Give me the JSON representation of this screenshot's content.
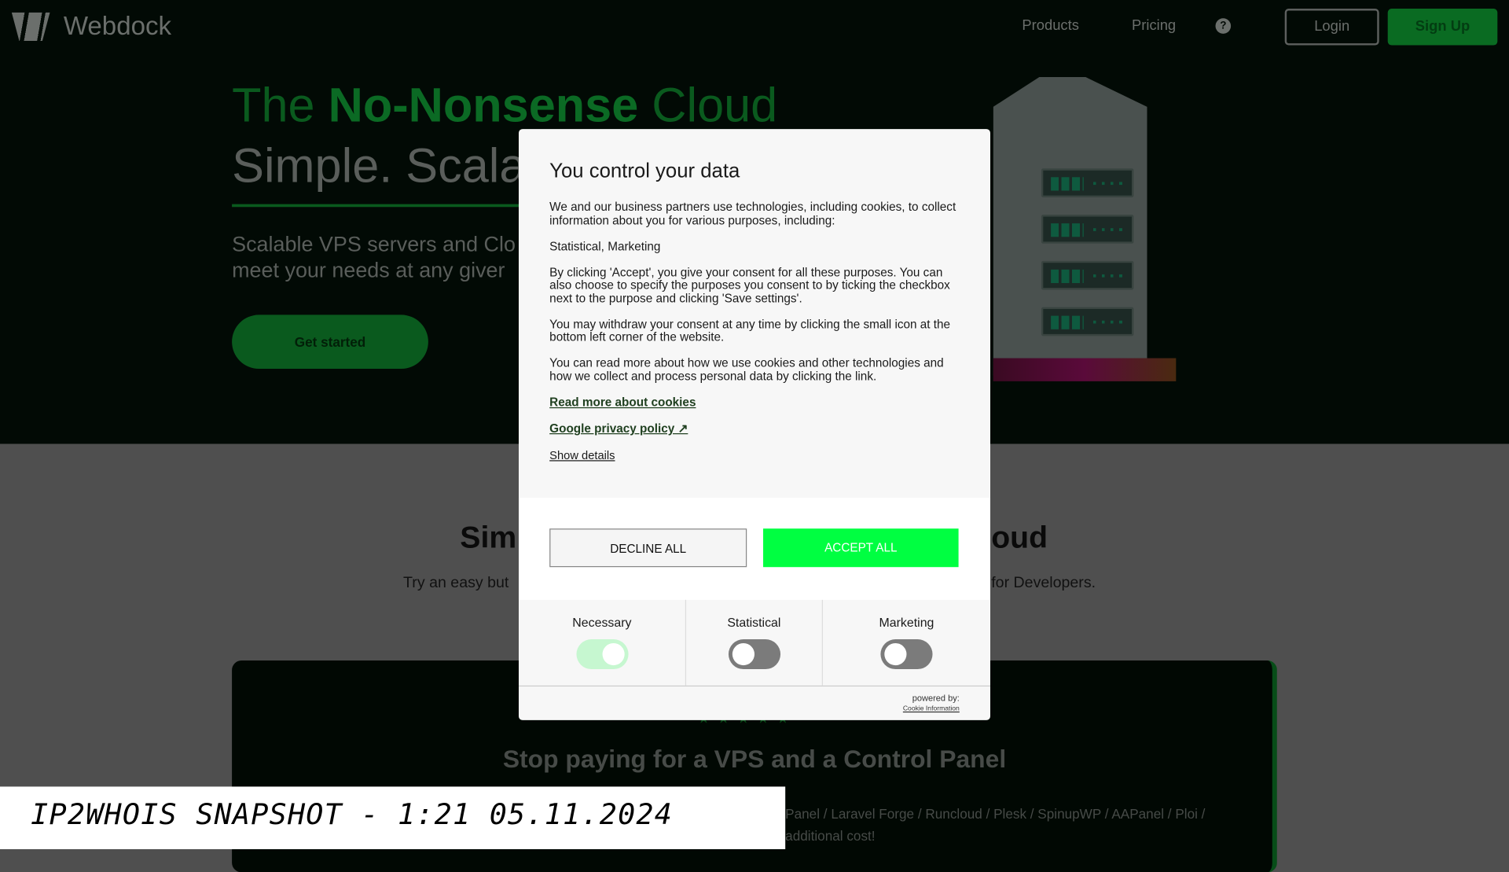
{
  "header": {
    "brand": "Webdock",
    "nav": [
      "Products",
      "Pricing"
    ],
    "help_icon": "question-circle-icon",
    "login": "Login",
    "signup": "Sign Up"
  },
  "hero": {
    "title_pre": "The ",
    "title_bold": "No-Nonsense",
    "title_post": " Cloud",
    "title_line2": "Simple. Scala",
    "subtitle_l1": "Scalable VPS servers and Clo",
    "subtitle_l2": "meet your needs at any giver",
    "cta": "Get started"
  },
  "section": {
    "title_left": "Sim",
    "title_right": "oud",
    "sub_left": "Try an easy but",
    "sub_right": "for Developers."
  },
  "card": {
    "stars": "★★★★★",
    "title": "Stop paying for a VPS and a Control Panel",
    "text_l1": "Panel / Laravel Forge / Runcloud / Plesk / SpinupWP / AAPanel / Ploi /",
    "text_l2": "additional cost!"
  },
  "consent": {
    "title": "You control your data",
    "p1": "We and our business partners use technologies, including cookies, to collect information about you for various purposes, including:",
    "p2": "Statistical, Marketing",
    "p3": "By clicking 'Accept', you give your consent for all these purposes. You can also choose to specify the purposes you consent to by ticking the checkbox next to the purpose and clicking 'Save settings'.",
    "p4": "You may withdraw your consent at any time by clicking the small icon at the bottom left corner of the website.",
    "p5": "You can read more about how we use cookies and other technologies and how we collect and process personal data by clicking the link.",
    "link_cookies": "Read more about cookies",
    "link_google": "Google privacy policy ↗",
    "show_details": "Show details",
    "decline": "DECLINE ALL",
    "accept": "ACCEPT ALL",
    "accept_color": "#00ff41",
    "toggles": [
      {
        "label": "Necessary",
        "on": true
      },
      {
        "label": "Statistical",
        "on": false
      },
      {
        "label": "Marketing",
        "on": false
      }
    ],
    "powered_by": "powered by:",
    "powered_name": "Cookie Information"
  },
  "watermark": "IP2WHOIS SNAPSHOT - 1:21 05.11.2024"
}
